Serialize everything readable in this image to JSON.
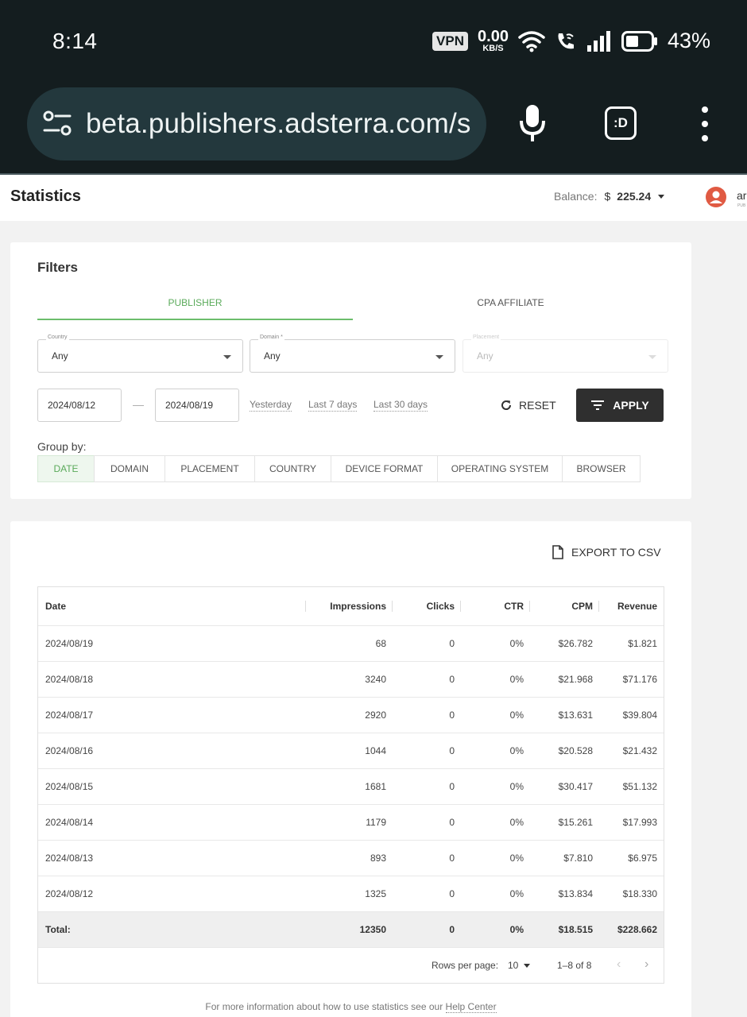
{
  "status_bar": {
    "time": "8:14",
    "vpn": "VPN",
    "speed_value": "0.00",
    "speed_unit": "KB/S",
    "battery": "43%"
  },
  "browser": {
    "url": "beta.publishers.adsterra.com/s",
    "tab_label": ":D"
  },
  "header": {
    "title": "Statistics",
    "balance_label": "Balance:",
    "currency": "$",
    "balance_amount": "225.24",
    "user_name": "ar",
    "user_role": "PUB"
  },
  "filters": {
    "title": "Filters",
    "tabs": [
      "PUBLISHER",
      "CPA AFFILIATE"
    ],
    "country_label": "Country",
    "country_value": "Any",
    "domain_label": "Domain *",
    "domain_value": "Any",
    "placement_label": "Placement",
    "placement_value": "Any",
    "date_from": "2024/08/12",
    "date_separator": "—",
    "date_to": "2024/08/19",
    "quick_ranges": [
      "Yesterday",
      "Last 7 days",
      "Last 30 days"
    ],
    "reset_label": "RESET",
    "apply_label": "APPLY",
    "group_by_label": "Group by:",
    "group_by": [
      "DATE",
      "DOMAIN",
      "PLACEMENT",
      "COUNTRY",
      "DEVICE FORMAT",
      "OPERATING SYSTEM",
      "BROWSER"
    ]
  },
  "table": {
    "export_label": "EXPORT TO CSV",
    "columns": [
      "Date",
      "Impressions",
      "Clicks",
      "CTR",
      "CPM",
      "Revenue"
    ],
    "rows": [
      [
        "2024/08/19",
        "68",
        "0",
        "0%",
        "$26.782",
        "$1.821"
      ],
      [
        "2024/08/18",
        "3240",
        "0",
        "0%",
        "$21.968",
        "$71.176"
      ],
      [
        "2024/08/17",
        "2920",
        "0",
        "0%",
        "$13.631",
        "$39.804"
      ],
      [
        "2024/08/16",
        "1044",
        "0",
        "0%",
        "$20.528",
        "$21.432"
      ],
      [
        "2024/08/15",
        "1681",
        "0",
        "0%",
        "$30.417",
        "$51.132"
      ],
      [
        "2024/08/14",
        "1179",
        "0",
        "0%",
        "$15.261",
        "$17.993"
      ],
      [
        "2024/08/13",
        "893",
        "0",
        "0%",
        "$7.810",
        "$6.975"
      ],
      [
        "2024/08/12",
        "1325",
        "0",
        "0%",
        "$13.834",
        "$18.330"
      ]
    ],
    "total": [
      "Total:",
      "12350",
      "0",
      "0%",
      "$18.515",
      "$228.662"
    ],
    "rows_per_page_label": "Rows per page:",
    "rows_per_page": "10",
    "range": "1–8 of 8"
  },
  "help": {
    "prefix": "For more information about how to use statistics see our ",
    "link": "Help Center"
  }
}
